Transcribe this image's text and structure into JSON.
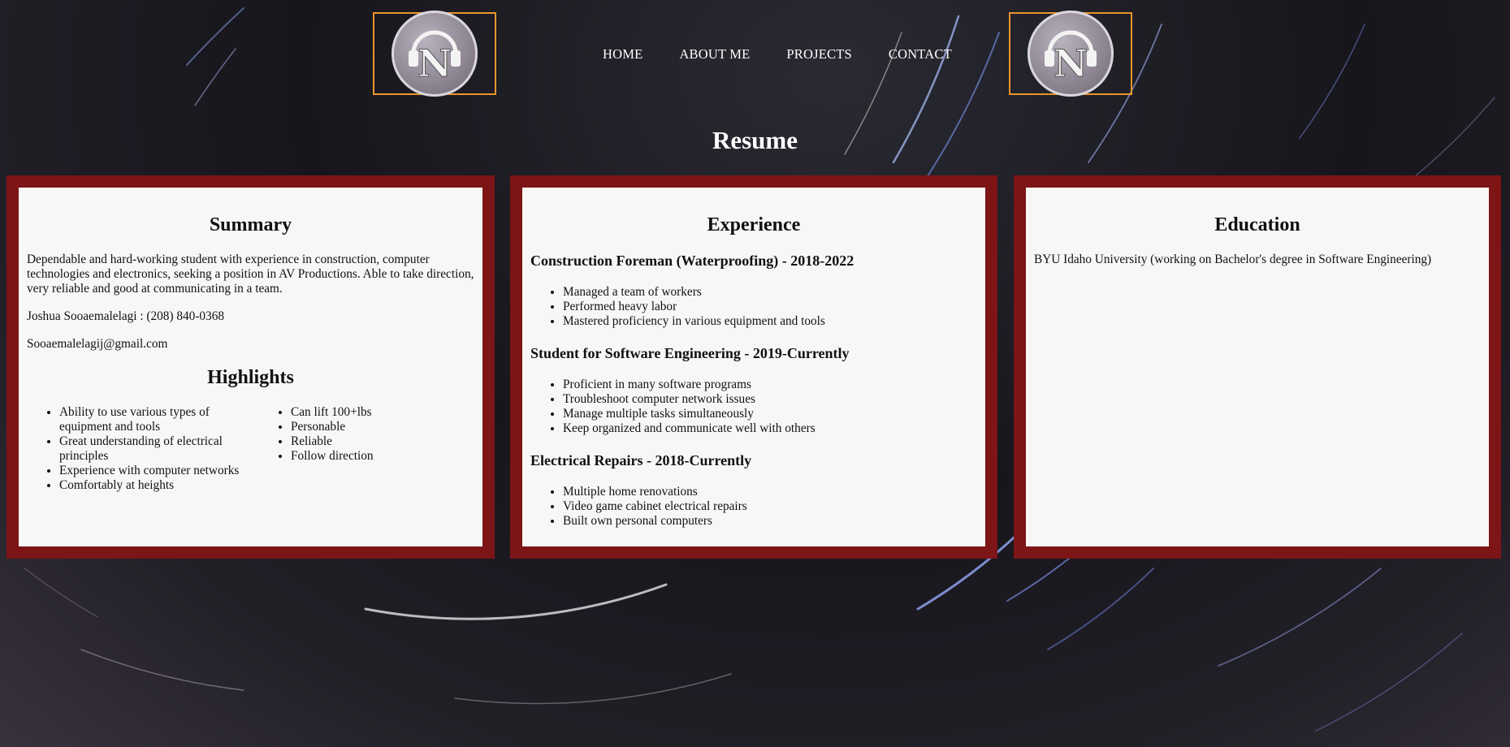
{
  "nav": {
    "items": [
      {
        "label": "HOME"
      },
      {
        "label": "ABOUT ME"
      },
      {
        "label": "PROJECTS"
      },
      {
        "label": "CONTACT"
      }
    ]
  },
  "logo": {
    "letter": "N",
    "icon": "headphones-n-logo"
  },
  "page": {
    "title": "Resume"
  },
  "summary": {
    "title": "Summary",
    "text": "Dependable and hard-working student with experience in construction, computer technologies and electronics, seeking a position in AV Productions. Able to take direction, very reliable and good at communicating in a team.",
    "contact_phone": "Joshua Sooaemalelagi : (208) 840-0368",
    "contact_email": "Sooaemalelagij@gmail.com"
  },
  "highlights": {
    "title": "Highlights",
    "left": [
      "Ability to use various types of equipment and tools",
      "Great understanding of electrical principles",
      "Experience with computer networks",
      "Comfortably at heights"
    ],
    "right": [
      "Can lift 100+lbs",
      "Personable",
      "Reliable",
      "Follow direction"
    ]
  },
  "experience": {
    "title": "Experience",
    "jobs": [
      {
        "title": "Construction Foreman (Waterproofing) - 2018-2022",
        "items": [
          "Managed a team of workers",
          "Performed heavy labor",
          "Mastered proficiency in various equipment and tools"
        ]
      },
      {
        "title": "Student for Software Engineering - 2019-Currently",
        "items": [
          "Proficient in many software programs",
          "Troubleshoot computer network issues",
          "Manage multiple tasks simultaneously",
          "Keep organized and communicate well with others"
        ]
      },
      {
        "title": "Electrical Repairs - 2018-Currently",
        "items": [
          "Multiple home renovations",
          "Video game cabinet electrical repairs",
          "Built own personal computers"
        ]
      }
    ]
  },
  "education": {
    "title": "Education",
    "text": "BYU Idaho University (working on Bachelor's degree in Software Engineering)"
  },
  "colors": {
    "accent_border": "#e8962a",
    "card_frame": "#7d1416",
    "card_bg": "#f7f7f5"
  }
}
